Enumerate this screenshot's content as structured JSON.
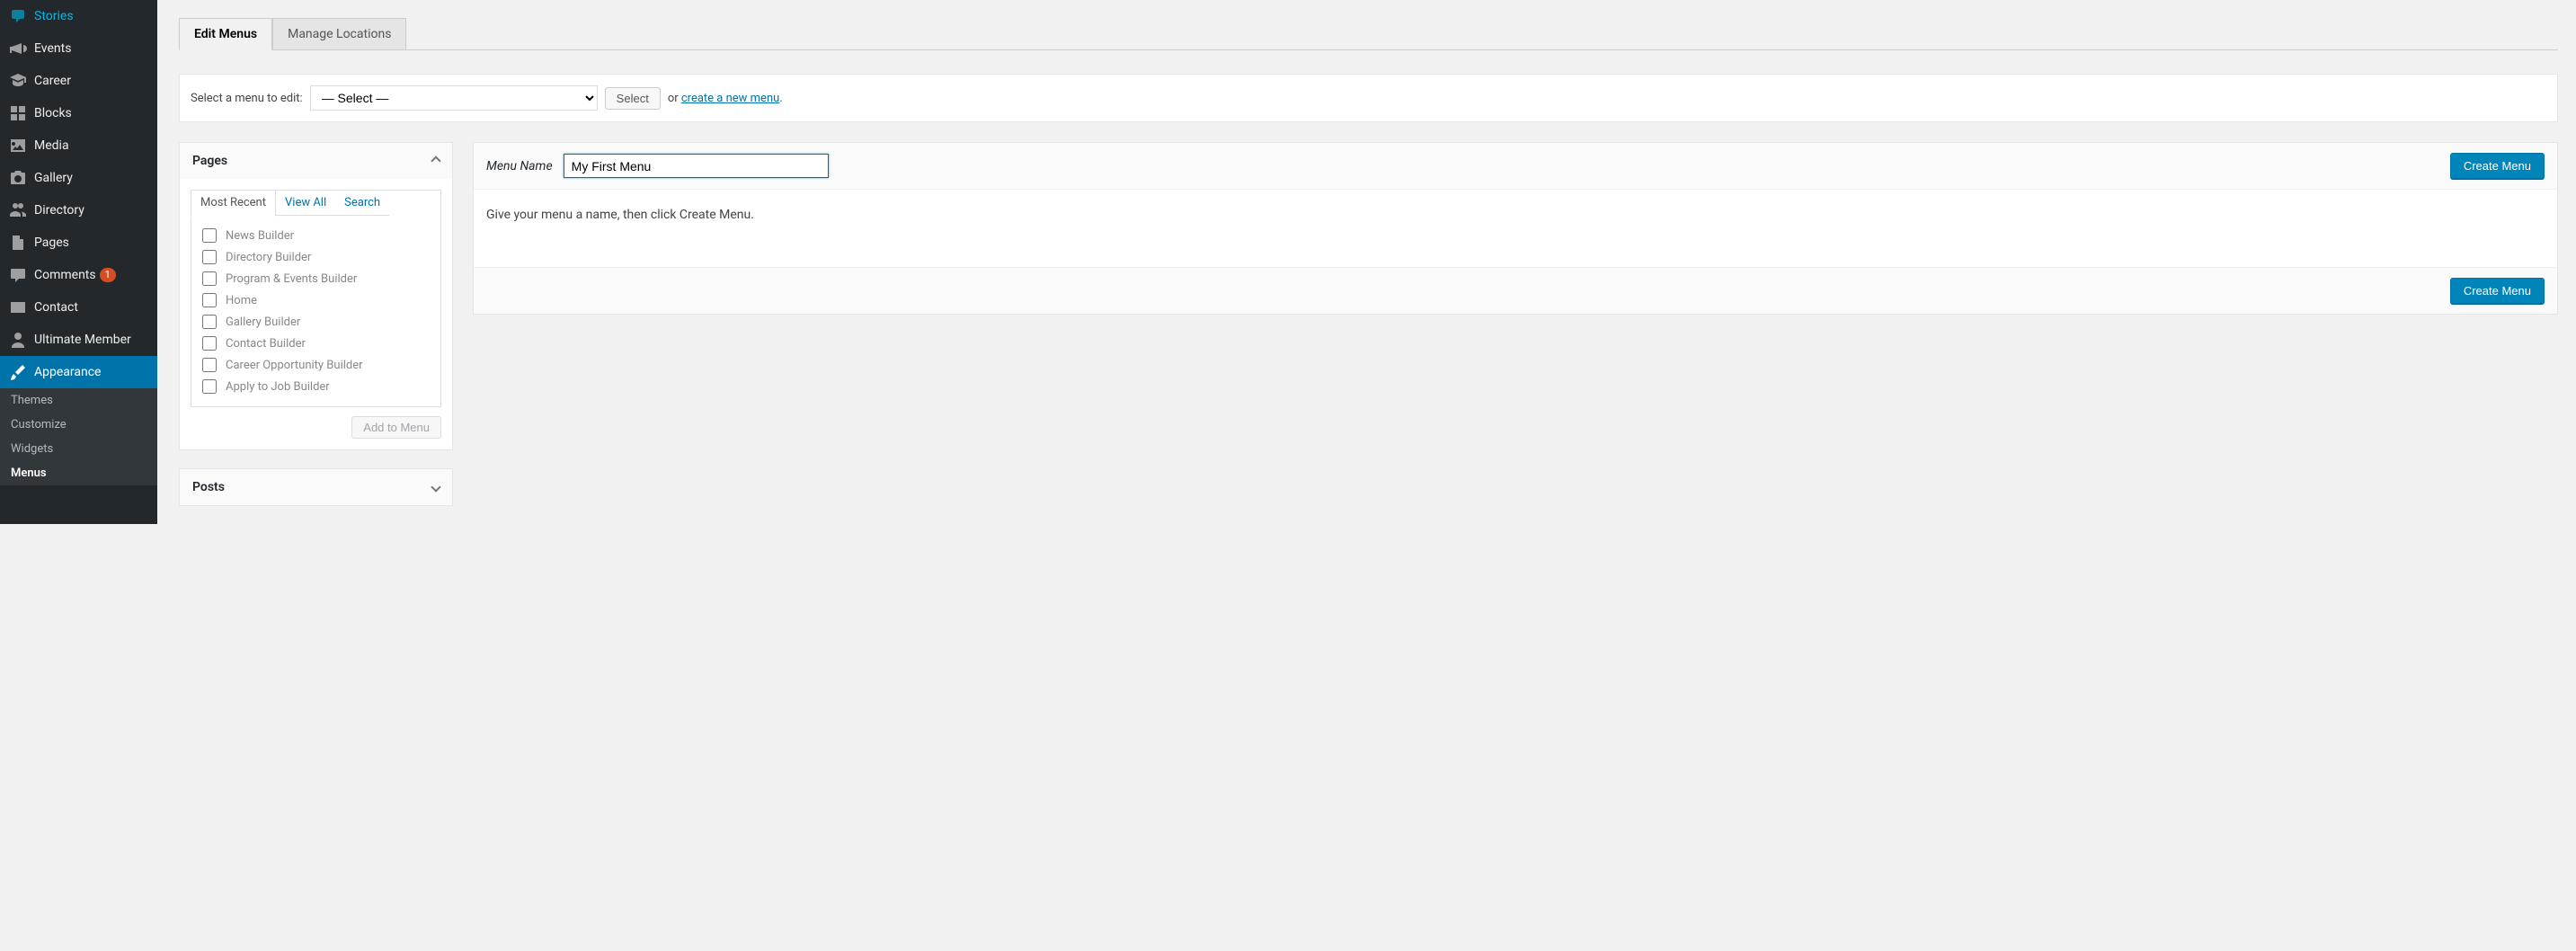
{
  "sidebar": {
    "items": [
      {
        "label": "Stories"
      },
      {
        "label": "Events"
      },
      {
        "label": "Career"
      },
      {
        "label": "Blocks"
      },
      {
        "label": "Media"
      },
      {
        "label": "Gallery"
      },
      {
        "label": "Directory"
      },
      {
        "label": "Pages"
      },
      {
        "label": "Comments",
        "badge": "1"
      },
      {
        "label": "Contact"
      },
      {
        "label": "Ultimate Member"
      },
      {
        "label": "Appearance"
      }
    ],
    "sub": [
      {
        "label": "Themes"
      },
      {
        "label": "Customize"
      },
      {
        "label": "Widgets"
      },
      {
        "label": "Menus"
      }
    ]
  },
  "tabs": {
    "edit": "Edit Menus",
    "manage": "Manage Locations"
  },
  "selector": {
    "label": "Select a menu to edit:",
    "option": "— Select —",
    "selectBtn": "Select",
    "orText": "or ",
    "createLink": "create a new menu",
    "period": "."
  },
  "pagesBox": {
    "title": "Pages",
    "tabs": {
      "recent": "Most Recent",
      "all": "View All",
      "search": "Search"
    },
    "items": [
      "News Builder",
      "Directory Builder",
      "Program & Events Builder",
      "Home",
      "Gallery Builder",
      "Contact Builder",
      "Career Opportunity Builder",
      "Apply to Job Builder"
    ],
    "addBtn": "Add to Menu"
  },
  "postsBox": {
    "title": "Posts"
  },
  "menu": {
    "nameLabel": "Menu Name",
    "nameValue": "My First Menu",
    "hint": "Give your menu a name, then click Create Menu.",
    "createBtn": "Create Menu"
  }
}
